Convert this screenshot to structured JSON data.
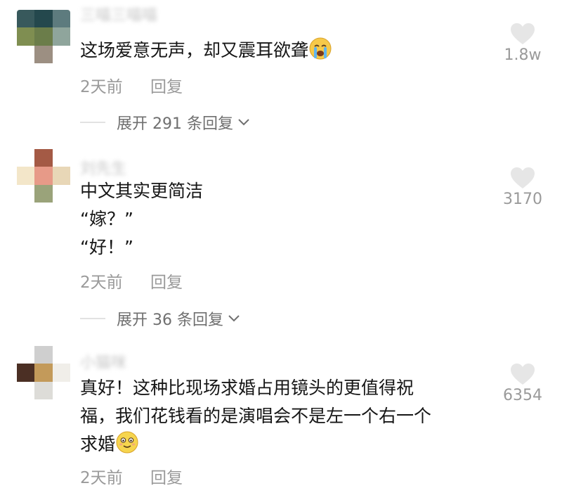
{
  "comments": [
    {
      "username": "三喵三喵喵",
      "text_lines": [
        "这场爱意无声，却又震耳欲聋"
      ],
      "emoji": "crying-emoji",
      "time": "2天前",
      "reply": "回复",
      "likes": "1.8w",
      "expand": "展开 291 条回复"
    },
    {
      "username": "刘先生",
      "text_lines": [
        "中文其实更简洁",
        "“嫁？”",
        "“好！”"
      ],
      "time": "2天前",
      "reply": "回复",
      "likes": "3170",
      "expand": "展开 36 条回复"
    },
    {
      "username": "小猫咪",
      "text_lines": [
        "真好！这种比现场求婚占用镜头的更值得祝",
        "福，我们花钱看的是演唱会不是左一个右一个",
        "求婚"
      ],
      "emoji": "smiling-emoji",
      "time": "2天前",
      "reply": "回复",
      "likes": "6354"
    }
  ],
  "colors": {
    "text": "#161616",
    "meta": "#9a9a9a",
    "heart": "#e6e6e6"
  }
}
